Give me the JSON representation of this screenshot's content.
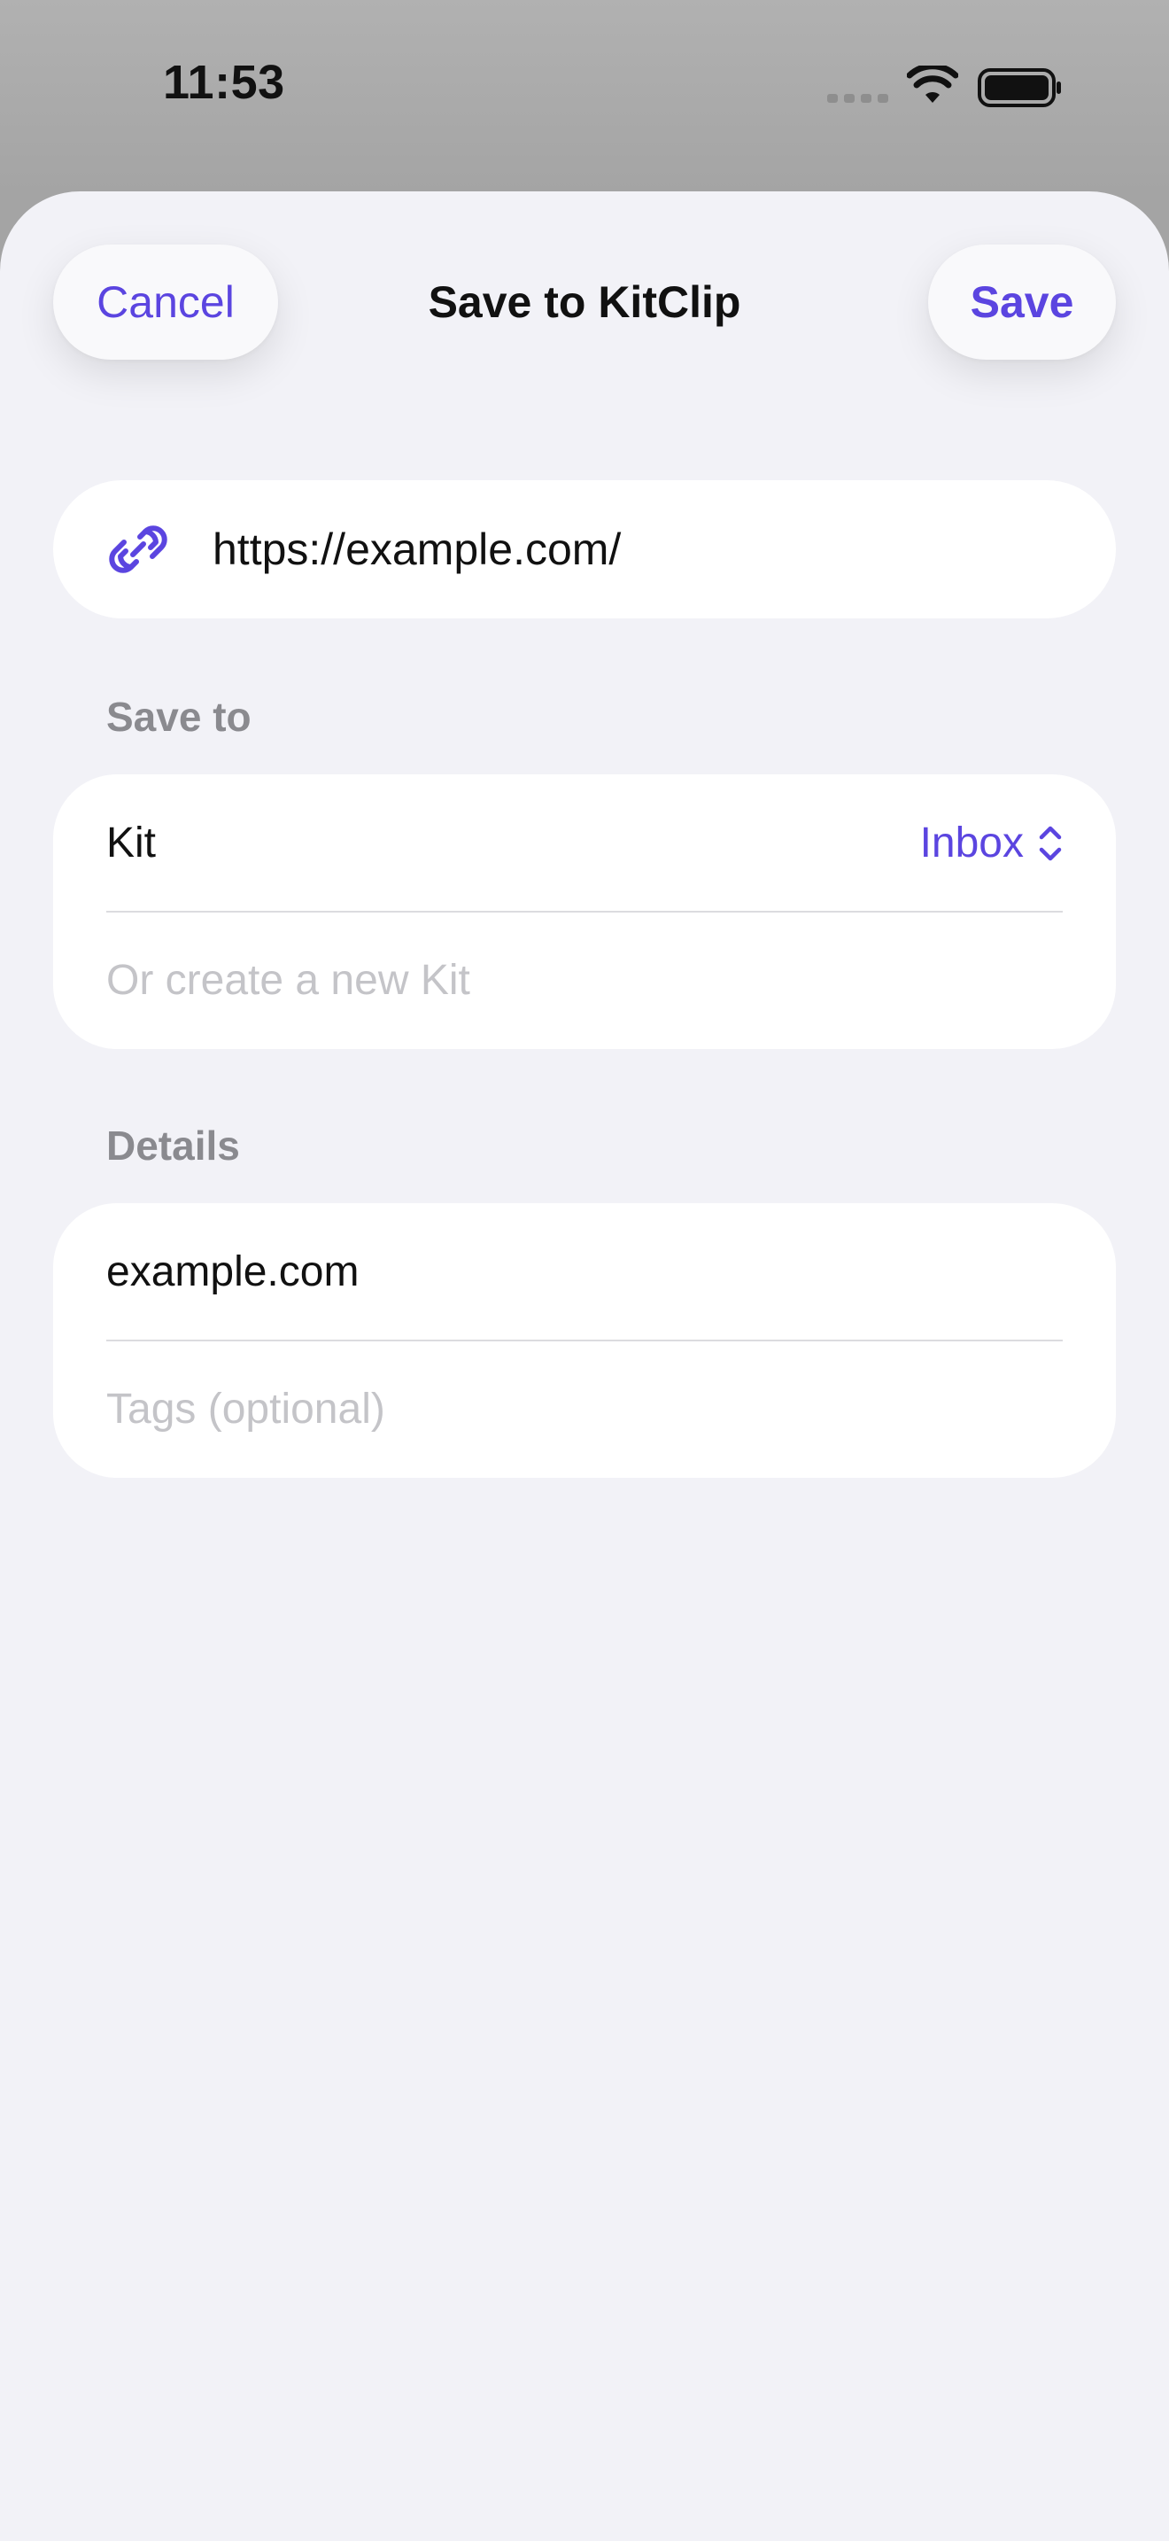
{
  "status_bar": {
    "time": "11:53"
  },
  "nav": {
    "cancel_label": "Cancel",
    "title": "Save to KitClip",
    "save_label": "Save"
  },
  "url_field": {
    "value": "https://example.com/",
    "icon": "link-icon"
  },
  "save_to_section": {
    "header": "Save to",
    "kit_label": "Kit",
    "kit_selected": "Inbox",
    "new_kit_placeholder": "Or create a new Kit"
  },
  "details_section": {
    "header": "Details",
    "title_value": "example.com",
    "tags_placeholder": "Tags (optional)"
  },
  "colors": {
    "accent": "#5b45e0",
    "sheet_background": "#f2f2f7",
    "card_background": "#ffffff",
    "secondary_text": "#8a8a8f",
    "placeholder_text": "#c4c4c8"
  }
}
